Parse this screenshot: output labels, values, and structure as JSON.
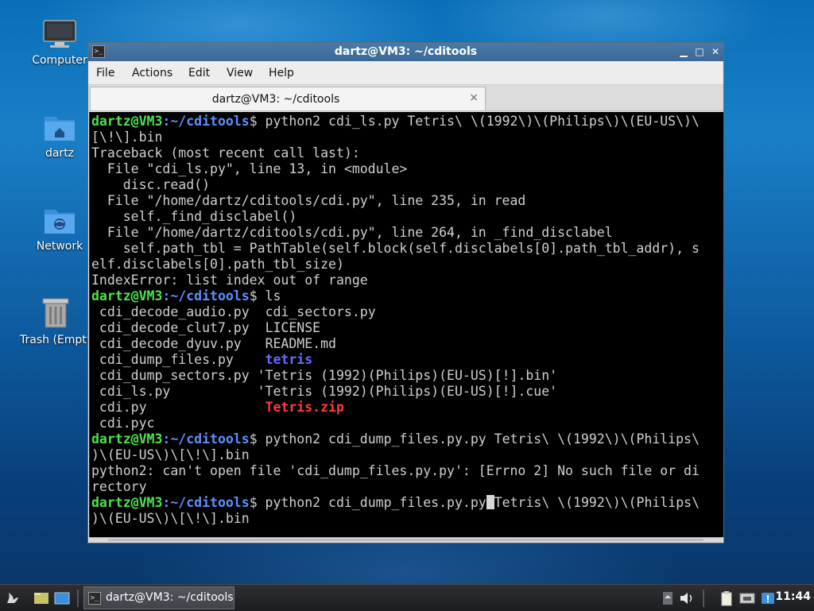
{
  "desktop": {
    "icons": [
      {
        "label": "Computer"
      },
      {
        "label": "dartz"
      },
      {
        "label": "Network"
      },
      {
        "label": "Trash (Empty)"
      }
    ]
  },
  "window": {
    "title": "dartz@VM3: ~/cditools",
    "menu": [
      "File",
      "Actions",
      "Edit",
      "View",
      "Help"
    ],
    "tab_title": "dartz@VM3: ~/cditools",
    "tab_close": "×"
  },
  "terminal": {
    "prompt_user": "dartz@VM3",
    "prompt_path": ":~/cditools",
    "prompt_sym": "$",
    "lines": [
      {
        "cmd": " python2 cdi_ls.py Tetris\\ \\(1992\\)\\(Philips\\)\\(EU-US\\)\\"
      },
      {
        "text": "[\\!\\].bin"
      },
      {
        "text": "Traceback (most recent call last):"
      },
      {
        "text": "  File \"cdi_ls.py\", line 13, in <module>"
      },
      {
        "text": "    disc.read()"
      },
      {
        "text": "  File \"/home/dartz/cditools/cdi.py\", line 235, in read"
      },
      {
        "text": "    self._find_disclabel()"
      },
      {
        "text": "  File \"/home/dartz/cditools/cdi.py\", line 264, in _find_disclabel"
      },
      {
        "text": "    self.path_tbl = PathTable(self.block(self.disclabels[0].path_tbl_addr), s"
      },
      {
        "text": "elf.disclabels[0].path_tbl_size)"
      },
      {
        "text": "IndexError: list index out of range"
      },
      {
        "cmd": " ls"
      }
    ],
    "ls": [
      {
        "a": "cdi_decode_audio.py",
        "b": "cdi_sectors.py",
        "bcls": ""
      },
      {
        "a": "cdi_decode_clut7.py",
        "b": "LICENSE",
        "bcls": ""
      },
      {
        "a": "cdi_decode_dyuv.py",
        "b": "README.md",
        "bcls": ""
      },
      {
        "a": "cdi_dump_files.py",
        "b": "tetris",
        "bcls": "dir"
      },
      {
        "a": "cdi_dump_sectors.py",
        "b": "'Tetris (1992)(Philips)(EU-US)[!].bin'",
        "bcls": ""
      },
      {
        "a": "cdi_ls.py",
        "b": "'Tetris (1992)(Philips)(EU-US)[!].cue'",
        "bcls": ""
      },
      {
        "a": "cdi.py",
        "b": "Tetris.zip",
        "bcls": "zip"
      },
      {
        "a": "cdi.pyc",
        "b": "",
        "bcls": ""
      }
    ],
    "after": [
      {
        "cmd": " python2 cdi_dump_files.py.py Tetris\\ \\(1992\\)\\(Philips\\"
      },
      {
        "text": ")\\(EU-US\\)\\[\\!\\].bin"
      },
      {
        "text": "python2: can't open file 'cdi_dump_files.py.py': [Errno 2] No such file or di"
      },
      {
        "text": "rectory"
      }
    ],
    "current_cmd_before": " python2 cdi_dump_files.py.py",
    "current_cmd_after": "Tetris\\ \\(1992\\)\\(Philips\\",
    "current_wrap": ")\\(EU-US\\)\\[\\!\\].bin"
  },
  "taskbar": {
    "task_label": "dartz@VM3: ~/cditools",
    "clock": "11:44"
  }
}
